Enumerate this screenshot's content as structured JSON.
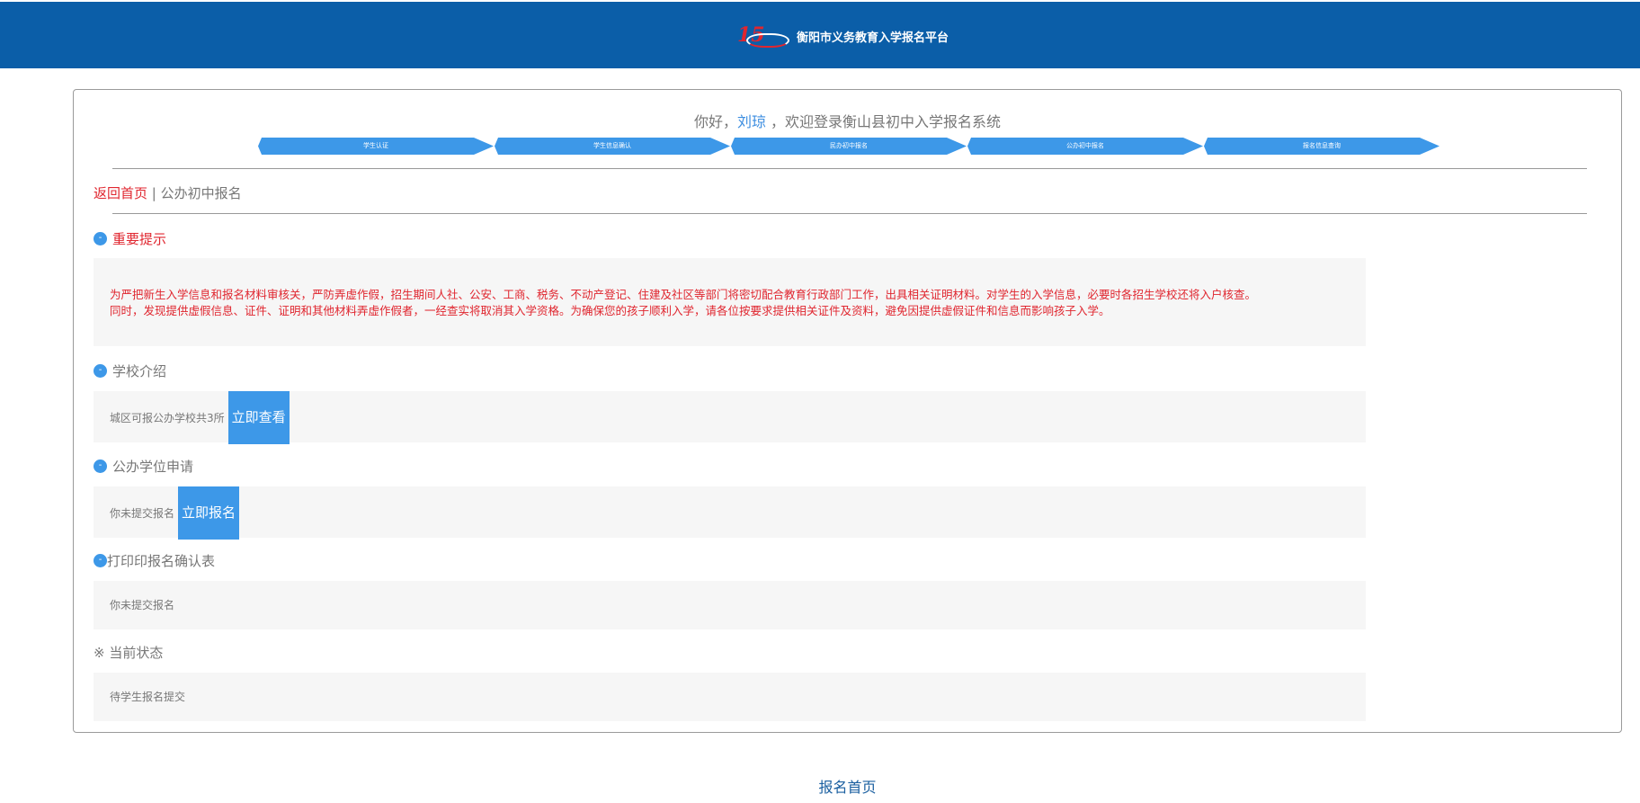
{
  "header": {
    "logo_text": "15",
    "title": "衡阳市义务教育入学报名平台"
  },
  "welcome": {
    "prefix": "你好，",
    "user": "刘琼",
    "suffix": " ，欢迎登录衡山县初中入学报名系统"
  },
  "steps": [
    {
      "label": "学生认证"
    },
    {
      "label": "学生信息确认"
    },
    {
      "label": "民办初中报名"
    },
    {
      "label": "公办初中报名"
    },
    {
      "label": "报名信息查询"
    }
  ],
  "breadcrumb": {
    "home": "返回首页",
    "separator": " | ",
    "current": "公办初中报名"
  },
  "sections": {
    "important": {
      "icon": "-",
      "title": "重要提示",
      "line1": "为严把新生入学信息和报名材料审核关，严防弄虚作假，招生期间人社、公安、工商、税务、不动产登记、住建及社区等部门将密切配合教育行政部门工作，出具相关证明材料。对学生的入学信息，必要时各招生学校还将入户核查。",
      "line2": "同时，发现提供虚假信息、证件、证明和其他材料弄虚作假者，一经查实将取消其入学资格。为确保您的孩子顺利入学，请各位按要求提供相关证件及资料，避免因提供虚假证件和信息而影响孩子入学。"
    },
    "school_intro": {
      "icon": "-",
      "title": "学校介绍",
      "text": "城区可报公办学校共3所",
      "button": "立即查看"
    },
    "apply": {
      "icon": "-",
      "title": "公办学位申请",
      "text": "你未提交报名",
      "button": "立即报名"
    },
    "print": {
      "icon": "-",
      "title": "打印印报名确认表",
      "text": "你未提交报名"
    },
    "status": {
      "title": "※ 当前状态",
      "text": "待学生报名提交"
    }
  },
  "footer": {
    "link": "报名首页"
  },
  "colors": {
    "header_bg": "#0b5ea8",
    "accent_blue": "#3d98e8",
    "alert_red": "#e0262f"
  }
}
